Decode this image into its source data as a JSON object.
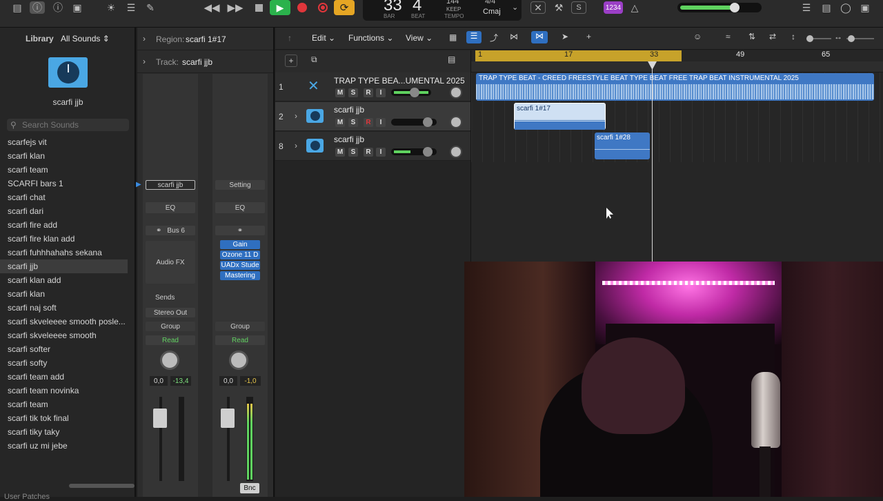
{
  "toolbar": {
    "lcd_bar": "33",
    "lcd_beat": "4",
    "lcd_bar_label": "BAR",
    "lcd_beat_label": "BEAT",
    "lcd_tempo": "144",
    "lcd_keep": "KEEP",
    "lcd_tempo_label": "TEMPO",
    "lcd_sig": "4/4",
    "lcd_key": "Cmaj",
    "count_in": "1234",
    "colors": {
      "play": "#2bb24c",
      "record": "#e0363b",
      "cycle": "#e6a624",
      "accent": "#3a7bd5"
    }
  },
  "library": {
    "title": "Library",
    "dropdown": "All Sounds",
    "patch_name": "scarfi jjb",
    "search_placeholder": "Search Sounds",
    "items": [
      "scarfejs vit",
      "scarfi  klan",
      "scarfi  team",
      "SCARFI bars 1",
      "scarfi chat",
      "scarfi dari",
      "scarfi fire add",
      "scarfi fire klan add",
      "scarfi fuhhhahahs sekana",
      "scarfi jjb",
      "scarfi klan add",
      "scarfi klan",
      "scarfi naj soft",
      "scarfi skveleeee smooth posle...",
      "scarfi skveleeee smooth",
      "scarfi softer",
      "scarfi softy",
      "scarfi team add",
      "scarfi team novinka",
      "scarfi team",
      "scarfi tik tok final",
      "scarfi tiky taky",
      "scarfi uz mi jebe"
    ],
    "selected_index": 9,
    "footer": "User Patches"
  },
  "inspector": {
    "region_label": "Region:",
    "region_name": "scarfi 1#17",
    "track_label": "Track:",
    "track_name": "scarfi jjb",
    "strip1": {
      "setting": "scarfi jjb",
      "eq": "EQ",
      "input": "Bus 6",
      "audio_fx": "Audio FX",
      "sends": "Sends",
      "output": "Stereo Out",
      "group": "Group",
      "auto": "Read",
      "vol": "0,0",
      "peak": "-13,4"
    },
    "strip2": {
      "setting": "Setting",
      "eq": "EQ",
      "plugins": [
        "Gain",
        "Ozone 11 D",
        "UADx Stude",
        "Mastering"
      ],
      "group": "Group",
      "auto": "Read",
      "vol": "0,0",
      "peak": "-1,0",
      "bottom": "Bnc"
    }
  },
  "main": {
    "menu": {
      "edit": "Edit",
      "functions": "Functions",
      "view": "View"
    },
    "ruler": [
      "1",
      "17",
      "33",
      "49",
      "65"
    ],
    "playhead_bar": 33,
    "tracks": [
      {
        "num": "1",
        "name": "TRAP TYPE BEA...UMENTAL 2025",
        "m": "M",
        "s": "S",
        "r": "R",
        "i": "I"
      },
      {
        "num": "2",
        "name": "scarfi jjb",
        "m": "M",
        "s": "S",
        "r": "R",
        "i": "I"
      },
      {
        "num": "8",
        "name": "scarfi jjb",
        "m": "M",
        "s": "S",
        "r": "R",
        "i": "I"
      }
    ],
    "regions": [
      {
        "label": "TRAP TYPE BEAT - CREED  FREESTYLE BEAT  TYPE BEAT  FREE TRAP BEAT INSTRUMENTAL 2025"
      },
      {
        "label": "scarfi 1#17"
      },
      {
        "label": "scarfi 1#28"
      }
    ]
  }
}
